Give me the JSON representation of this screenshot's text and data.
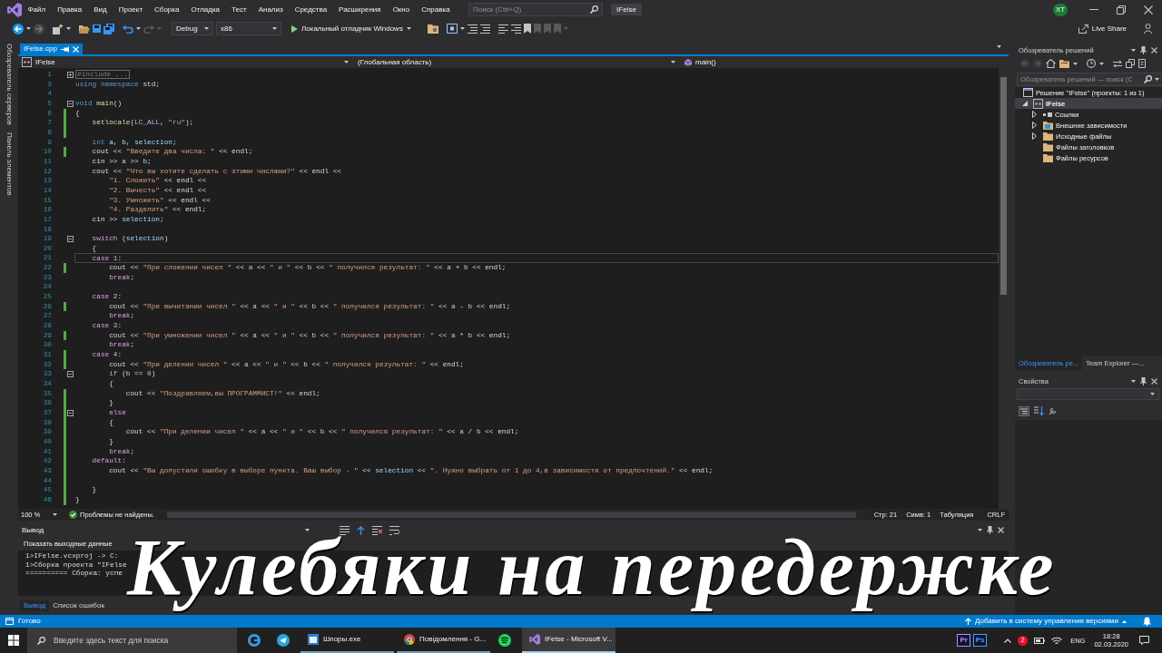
{
  "window": {
    "title": "IFelse",
    "account_initials": "XT"
  },
  "menu": [
    "Файл",
    "Правка",
    "Вид",
    "Проект",
    "Сборка",
    "Отладка",
    "Тест",
    "Анализ",
    "Средства",
    "Расширения",
    "Окно",
    "Справка"
  ],
  "search": {
    "placeholder": "Поиск (Ctrl+Q)"
  },
  "toolbar": {
    "navigate_back": {
      "disabled": false
    },
    "navigate_forward": {
      "disabled": true
    },
    "undo": {
      "disabled": false
    },
    "redo": {
      "disabled": true
    },
    "configuration": "Debug",
    "platform": "x86",
    "start_debugging": "Локальный отладчик Windows",
    "live_share": "Live Share"
  },
  "side_tabs": [
    "Обозреватель серверов",
    "Панель элементов"
  ],
  "document_tabs": [
    {
      "label": "IFelse.cpp",
      "selected": true
    }
  ],
  "navigation_bar": {
    "project": "IFelse",
    "scope": "(Глобальная область)",
    "member": "main()"
  },
  "editor": {
    "lines": [
      {
        "number": "1",
        "expanded": false,
        "changed": false,
        "current": false,
        "tokens": [
          {
            "kind": "collapsed",
            "text": "#include ..."
          }
        ]
      },
      {
        "number": "3",
        "changed": false,
        "current": false,
        "tokens": [
          {
            "kind": "keyword",
            "text": "using namespace"
          },
          {
            "kind": "plain",
            "text": " std;"
          }
        ]
      },
      {
        "number": "4",
        "changed": false,
        "current": false
      },
      {
        "number": "5",
        "expanded": true,
        "changed": false,
        "current": false,
        "tokens": [
          {
            "kind": "keyword",
            "text": "void "
          },
          {
            "kind": "function",
            "text": "main"
          },
          {
            "kind": "plain",
            "text": "()"
          }
        ]
      },
      {
        "number": "6",
        "changed": true,
        "current": false,
        "tokens": [
          {
            "kind": "plain",
            "text": "{"
          }
        ]
      },
      {
        "number": "7",
        "changed": true,
        "current": false,
        "tokens": [
          {
            "kind": "function",
            "text": "    setlocale"
          },
          {
            "kind": "plain",
            "text": "("
          },
          {
            "kind": "macro",
            "text": "LC_ALL"
          },
          {
            "kind": "plain",
            "text": ", "
          },
          {
            "kind": "string",
            "text": "\"ru\""
          },
          {
            "kind": "plain",
            "text": ");"
          }
        ]
      },
      {
        "number": "8",
        "changed": true,
        "current": false
      },
      {
        "number": "9",
        "changed": false,
        "current": false,
        "tokens": [
          {
            "kind": "keyword",
            "text": "    int "
          },
          {
            "kind": "variable",
            "text": "a"
          },
          {
            "kind": "plain",
            "text": ", "
          },
          {
            "kind": "variable",
            "text": "b"
          },
          {
            "kind": "plain",
            "text": ", "
          },
          {
            "kind": "variable",
            "text": "selection"
          },
          {
            "kind": "plain",
            "text": ";"
          }
        ]
      },
      {
        "number": "10",
        "changed": true,
        "current": false,
        "tokens": [
          {
            "kind": "plain",
            "text": "    cout << "
          },
          {
            "kind": "string",
            "text": "\"Введите два числа: \""
          },
          {
            "kind": "plain",
            "text": " << endl;"
          }
        ]
      },
      {
        "number": "11",
        "changed": false,
        "current": false,
        "tokens": [
          {
            "kind": "plain",
            "text": "    cin >> "
          },
          {
            "kind": "variable",
            "text": "a"
          },
          {
            "kind": "plain",
            "text": " >> "
          },
          {
            "kind": "variable",
            "text": "b"
          },
          {
            "kind": "plain",
            "text": ";"
          }
        ]
      },
      {
        "number": "12",
        "changed": false,
        "current": false,
        "tokens": [
          {
            "kind": "plain",
            "text": "    cout << "
          },
          {
            "kind": "string",
            "text": "\"Что вы хотите сделать с этими числами?\""
          },
          {
            "kind": "plain",
            "text": " << endl <<"
          }
        ]
      },
      {
        "number": "13",
        "changed": false,
        "current": false,
        "tokens": [
          {
            "kind": "string",
            "text": "        \"1. Сложить\""
          },
          {
            "kind": "plain",
            "text": " << endl <<"
          }
        ]
      },
      {
        "number": "14",
        "changed": false,
        "current": false,
        "tokens": [
          {
            "kind": "string",
            "text": "        \"2. Вычесть\""
          },
          {
            "kind": "plain",
            "text": " << endl <<"
          }
        ]
      },
      {
        "number": "15",
        "changed": false,
        "current": false,
        "tokens": [
          {
            "kind": "string",
            "text": "        \"3. Умножить\""
          },
          {
            "kind": "plain",
            "text": " << endl <<"
          }
        ]
      },
      {
        "number": "16",
        "changed": false,
        "current": false,
        "tokens": [
          {
            "kind": "string",
            "text": "        \"4. Разделить\""
          },
          {
            "kind": "plain",
            "text": " << endl;"
          }
        ]
      },
      {
        "number": "17",
        "changed": false,
        "current": false,
        "tokens": [
          {
            "kind": "plain",
            "text": "    cin >> "
          },
          {
            "kind": "variable",
            "text": "selection"
          },
          {
            "kind": "plain",
            "text": ";"
          }
        ]
      },
      {
        "number": "18",
        "changed": false,
        "current": false
      },
      {
        "number": "19",
        "expanded": true,
        "changed": false,
        "current": false,
        "tokens": [
          {
            "kind": "control",
            "text": "    switch"
          },
          {
            "kind": "plain",
            "text": " ("
          },
          {
            "kind": "variable",
            "text": "selection"
          },
          {
            "kind": "plain",
            "text": ")"
          }
        ]
      },
      {
        "number": "20",
        "changed": false,
        "current": false,
        "tokens": [
          {
            "kind": "plain",
            "text": "    {"
          }
        ]
      },
      {
        "number": "21",
        "changed": false,
        "current": true,
        "tokens": [
          {
            "kind": "control",
            "text": "    case "
          },
          {
            "kind": "number",
            "text": "1"
          },
          {
            "kind": "plain",
            "text": ":"
          }
        ]
      },
      {
        "number": "22",
        "changed": true,
        "current": false,
        "tokens": [
          {
            "kind": "plain",
            "text": "        cout << "
          },
          {
            "kind": "string",
            "text": "\"При сложении чисел \""
          },
          {
            "kind": "plain",
            "text": " << "
          },
          {
            "kind": "variable",
            "text": "a"
          },
          {
            "kind": "plain",
            "text": " << "
          },
          {
            "kind": "string",
            "text": "\" и \""
          },
          {
            "kind": "plain",
            "text": " << "
          },
          {
            "kind": "variable",
            "text": "b"
          },
          {
            "kind": "plain",
            "text": " << "
          },
          {
            "kind": "string",
            "text": "\" получился результат: \""
          },
          {
            "kind": "plain",
            "text": " << "
          },
          {
            "kind": "variable",
            "text": "a"
          },
          {
            "kind": "plain",
            "text": " + "
          },
          {
            "kind": "variable",
            "text": "b"
          },
          {
            "kind": "plain",
            "text": " << endl;"
          }
        ]
      },
      {
        "number": "23",
        "changed": false,
        "current": false,
        "tokens": [
          {
            "kind": "control",
            "text": "        break"
          },
          {
            "kind": "plain",
            "text": ";"
          }
        ]
      },
      {
        "number": "24",
        "changed": false,
        "current": false
      },
      {
        "number": "25",
        "changed": false,
        "current": false,
        "tokens": [
          {
            "kind": "control",
            "text": "    case "
          },
          {
            "kind": "number",
            "text": "2"
          },
          {
            "kind": "plain",
            "text": ":"
          }
        ]
      },
      {
        "number": "26",
        "changed": true,
        "current": false,
        "tokens": [
          {
            "kind": "plain",
            "text": "        cout << "
          },
          {
            "kind": "string",
            "text": "\"При вычитании чисел \""
          },
          {
            "kind": "plain",
            "text": " << "
          },
          {
            "kind": "variable",
            "text": "a"
          },
          {
            "kind": "plain",
            "text": " << "
          },
          {
            "kind": "string",
            "text": "\" и \""
          },
          {
            "kind": "plain",
            "text": " << "
          },
          {
            "kind": "variable",
            "text": "b"
          },
          {
            "kind": "plain",
            "text": " << "
          },
          {
            "kind": "string",
            "text": "\" получился результат: \""
          },
          {
            "kind": "plain",
            "text": " << "
          },
          {
            "kind": "variable",
            "text": "a"
          },
          {
            "kind": "plain",
            "text": " - "
          },
          {
            "kind": "variable",
            "text": "b"
          },
          {
            "kind": "plain",
            "text": " << endl;"
          }
        ]
      },
      {
        "number": "27",
        "changed": false,
        "current": false,
        "tokens": [
          {
            "kind": "control",
            "text": "        break"
          },
          {
            "kind": "plain",
            "text": ";"
          }
        ]
      },
      {
        "number": "28",
        "changed": false,
        "current": false,
        "tokens": [
          {
            "kind": "control",
            "text": "    case "
          },
          {
            "kind": "number",
            "text": "3"
          },
          {
            "kind": "plain",
            "text": ":"
          }
        ]
      },
      {
        "number": "29",
        "changed": true,
        "current": false,
        "tokens": [
          {
            "kind": "plain",
            "text": "        cout << "
          },
          {
            "kind": "string",
            "text": "\"При умножении чисел \""
          },
          {
            "kind": "plain",
            "text": " << "
          },
          {
            "kind": "variable",
            "text": "a"
          },
          {
            "kind": "plain",
            "text": " << "
          },
          {
            "kind": "string",
            "text": "\" и \""
          },
          {
            "kind": "plain",
            "text": " << "
          },
          {
            "kind": "variable",
            "text": "b"
          },
          {
            "kind": "plain",
            "text": " << "
          },
          {
            "kind": "string",
            "text": "\" получился результат: \""
          },
          {
            "kind": "plain",
            "text": " << "
          },
          {
            "kind": "variable",
            "text": "a"
          },
          {
            "kind": "plain",
            "text": " * "
          },
          {
            "kind": "variable",
            "text": "b"
          },
          {
            "kind": "plain",
            "text": " << endl;"
          }
        ]
      },
      {
        "number": "30",
        "changed": false,
        "current": false,
        "tokens": [
          {
            "kind": "control",
            "text": "        break"
          },
          {
            "kind": "plain",
            "text": ";"
          }
        ]
      },
      {
        "number": "31",
        "changed": true,
        "current": false,
        "tokens": [
          {
            "kind": "control",
            "text": "    case "
          },
          {
            "kind": "number",
            "text": "4"
          },
          {
            "kind": "plain",
            "text": ":"
          }
        ]
      },
      {
        "number": "32",
        "changed": true,
        "current": false,
        "tokens": [
          {
            "kind": "plain",
            "text": "        cout << "
          },
          {
            "kind": "string",
            "text": "\"При делении чисел \""
          },
          {
            "kind": "plain",
            "text": " << "
          },
          {
            "kind": "variable",
            "text": "a"
          },
          {
            "kind": "plain",
            "text": " << "
          },
          {
            "kind": "string",
            "text": "\" и \""
          },
          {
            "kind": "plain",
            "text": " << "
          },
          {
            "kind": "variable",
            "text": "b"
          },
          {
            "kind": "plain",
            "text": " << "
          },
          {
            "kind": "string",
            "text": "\" получился результат: \""
          },
          {
            "kind": "plain",
            "text": " << endl;"
          }
        ]
      },
      {
        "number": "33",
        "expanded": true,
        "changed": false,
        "current": false,
        "tokens": [
          {
            "kind": "control",
            "text": "        if"
          },
          {
            "kind": "plain",
            "text": " ("
          },
          {
            "kind": "variable",
            "text": "b"
          },
          {
            "kind": "plain",
            "text": " == "
          },
          {
            "kind": "number",
            "text": "0"
          },
          {
            "kind": "plain",
            "text": ")"
          }
        ]
      },
      {
        "number": "34",
        "changed": false,
        "current": false,
        "tokens": [
          {
            "kind": "plain",
            "text": "        {"
          }
        ]
      },
      {
        "number": "35",
        "changed": true,
        "current": false,
        "tokens": [
          {
            "kind": "plain",
            "text": "            cout << "
          },
          {
            "kind": "string",
            "text": "\"Поздравляем,вы ПРОГРАММИСТ!\""
          },
          {
            "kind": "plain",
            "text": " << endl;"
          }
        ]
      },
      {
        "number": "36",
        "changed": true,
        "current": false,
        "tokens": [
          {
            "kind": "plain",
            "text": "        }"
          }
        ]
      },
      {
        "number": "37",
        "expanded": true,
        "changed": true,
        "current": false,
        "tokens": [
          {
            "kind": "control",
            "text": "        else"
          }
        ]
      },
      {
        "number": "38",
        "changed": true,
        "current": false,
        "tokens": [
          {
            "kind": "plain",
            "text": "        {"
          }
        ]
      },
      {
        "number": "39",
        "changed": true,
        "current": false,
        "tokens": [
          {
            "kind": "plain",
            "text": "            cout << "
          },
          {
            "kind": "string",
            "text": "\"При делении чисел \""
          },
          {
            "kind": "plain",
            "text": " << "
          },
          {
            "kind": "variable",
            "text": "a"
          },
          {
            "kind": "plain",
            "text": " << "
          },
          {
            "kind": "string",
            "text": "\" и \""
          },
          {
            "kind": "plain",
            "text": " << "
          },
          {
            "kind": "variable",
            "text": "b"
          },
          {
            "kind": "plain",
            "text": " << "
          },
          {
            "kind": "string",
            "text": "\" получился результат: \""
          },
          {
            "kind": "plain",
            "text": " << "
          },
          {
            "kind": "variable",
            "text": "a"
          },
          {
            "kind": "plain",
            "text": " / "
          },
          {
            "kind": "variable",
            "text": "b"
          },
          {
            "kind": "plain",
            "text": " << endl;"
          }
        ]
      },
      {
        "number": "40",
        "changed": true,
        "current": false,
        "tokens": [
          {
            "kind": "plain",
            "text": "        }"
          }
        ]
      },
      {
        "number": "41",
        "changed": true,
        "current": false,
        "tokens": [
          {
            "kind": "control",
            "text": "        break"
          },
          {
            "kind": "plain",
            "text": ";"
          }
        ]
      },
      {
        "number": "42",
        "changed": true,
        "current": false,
        "tokens": [
          {
            "kind": "control",
            "text": "    default"
          },
          {
            "kind": "plain",
            "text": ":"
          }
        ]
      },
      {
        "number": "43",
        "changed": true,
        "current": false,
        "tokens": [
          {
            "kind": "plain",
            "text": "        cout << "
          },
          {
            "kind": "string",
            "text": "\"Вы допустили ошибку в выборе пункта. Ваш выбор - \""
          },
          {
            "kind": "plain",
            "text": " << "
          },
          {
            "kind": "variable",
            "text": "selection"
          },
          {
            "kind": "plain",
            "text": " << "
          },
          {
            "kind": "string",
            "text": "\". Нужно выбрать от 1 до 4,в зависимости от предпочтений.\""
          },
          {
            "kind": "plain",
            "text": " << endl;"
          }
        ]
      },
      {
        "number": "44",
        "changed": true,
        "current": false
      },
      {
        "number": "45",
        "changed": true,
        "current": false,
        "tokens": [
          {
            "kind": "plain",
            "text": "    }"
          }
        ]
      },
      {
        "number": "46",
        "changed": true,
        "current": false,
        "tokens": [
          {
            "kind": "plain",
            "text": "}"
          }
        ]
      }
    ]
  },
  "editor_status": {
    "zoom": "100 %",
    "issues": "Проблемы не найдены.",
    "line": "Стр: 21",
    "column": "Симв: 1",
    "indentation": "Табуляция",
    "line_endings": "CRLF"
  },
  "output": {
    "title": "Вывод",
    "source_label": "Показать выходные данные",
    "lines": [
      "1>IFelse.vcxproj -> C:",
      "1>Сборка проекта \"IFelse",
      "========== Сборка: успе"
    ],
    "tabs": [
      {
        "label": "Вывод",
        "selected": true
      },
      {
        "label": "Список ошибок",
        "selected": false
      }
    ]
  },
  "solution_explorer": {
    "title": "Обозреватель решений",
    "search": {
      "placeholder": "Обозреватель решений — поиск (C"
    },
    "tree": [
      {
        "label": "Решение \"IFelse\" (проекты: 1 из 1)",
        "kind": "solution",
        "selected": false,
        "children": [
          {
            "label": "IFelse",
            "kind": "project",
            "selected": true,
            "expanded": true,
            "children": [
              {
                "label": "Ссылки",
                "kind": "references",
                "selected": false,
                "expanded": false
              },
              {
                "label": "Внешние зависимости",
                "kind": "dependencies",
                "selected": false,
                "expanded": false
              },
              {
                "label": "Исходные файлы",
                "kind": "folder",
                "selected": false,
                "expanded": false
              },
              {
                "label": "Файлы заголовков",
                "kind": "folder",
                "selected": false
              },
              {
                "label": "Файлы ресурсов",
                "kind": "folder",
                "selected": false
              }
            ]
          }
        ]
      }
    ],
    "tabs": [
      {
        "label": "Обозреватель ре...",
        "selected": true
      },
      {
        "label": "Team Explorer —...",
        "selected": false
      }
    ]
  },
  "properties": {
    "title": "Свойства"
  },
  "status_bar": {
    "message": "Готово",
    "source_control": "Добавить в систему управления версиями"
  },
  "taskbar": {
    "search": {
      "placeholder": "Введите здесь текст для поиска"
    },
    "windows": [
      {
        "title": "Шпоры.exe",
        "kind": "program",
        "selected": false
      },
      {
        "title": "Повідомлення - G...",
        "kind": "browser",
        "selected": false
      },
      {
        "title": "IFelse - Microsoft V...",
        "kind": "ide",
        "selected": true
      }
    ],
    "tray_apps": [
      {
        "label": "Pr",
        "color": "#9999ff"
      },
      {
        "label": "Ps",
        "color": "#31a8ff"
      }
    ],
    "notification_count": "2",
    "language": "ENG",
    "time": "18:28",
    "date": "02.03.2020"
  },
  "caption": "Кулебяки на передержке"
}
